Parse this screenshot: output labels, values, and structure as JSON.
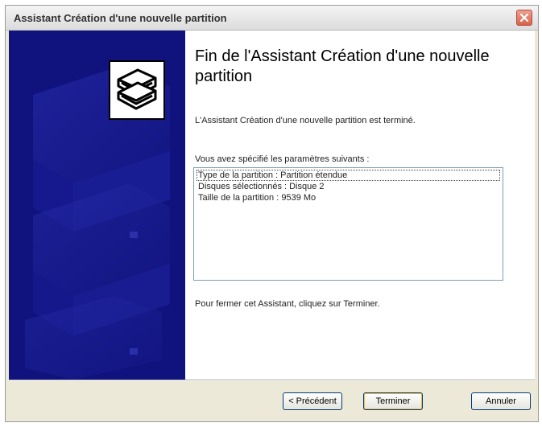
{
  "window": {
    "title": "Assistant Création d'une nouvelle partition",
    "close_icon": "close-icon"
  },
  "sidebar": {
    "icon": "book-stack-icon",
    "background_color": "#10137e"
  },
  "content": {
    "heading": "Fin de l'Assistant Création d'une nouvelle partition",
    "intro": "L'Assistant Création d'une nouvelle partition est terminé.",
    "params_label": "Vous avez spécifié les paramètres suivants :",
    "params": [
      "Type de la partition : Partition étendue",
      "Disques sélectionnés : Disque 2",
      "Taille de la partition : 9539 Mo"
    ],
    "finish_text": "Pour fermer cet Assistant, cliquez sur Terminer."
  },
  "buttons": {
    "previous": "< Précédent",
    "finish": "Terminer",
    "cancel": "Annuler"
  }
}
